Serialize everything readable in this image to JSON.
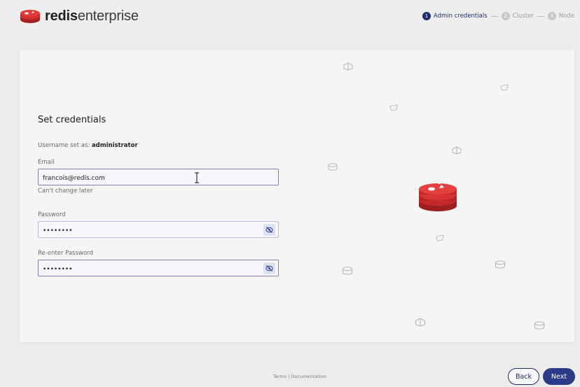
{
  "brand": {
    "bold": "redis",
    "light": "enterprise",
    "icon": "redis-logo-icon"
  },
  "steps": [
    {
      "num": "1",
      "label": "Admin credentials",
      "state": "active"
    },
    {
      "num": "2",
      "label": "Cluster",
      "state": "inactive"
    },
    {
      "num": "3",
      "label": "Node",
      "state": "inactive"
    }
  ],
  "form": {
    "title": "Set credentials",
    "username_prefix": "Username set as:",
    "username_value": "administrator",
    "email": {
      "label": "Email",
      "value": "francois@redis.com",
      "helper": "Can't change later"
    },
    "password": {
      "label": "Password",
      "value": "••••••••",
      "toggle_icon": "eye-off-icon"
    },
    "reenter": {
      "label": "Re-enter Password",
      "value": "••••••••",
      "toggle_icon": "eye-off-icon"
    }
  },
  "footer": {
    "links": "Terms | Documentation"
  },
  "buttons": {
    "back": "Back",
    "next": "Next"
  },
  "colors": {
    "accent": "#1f2d6b",
    "brand_red": "#d62d2d",
    "button_primary": "#2c3a8a"
  }
}
